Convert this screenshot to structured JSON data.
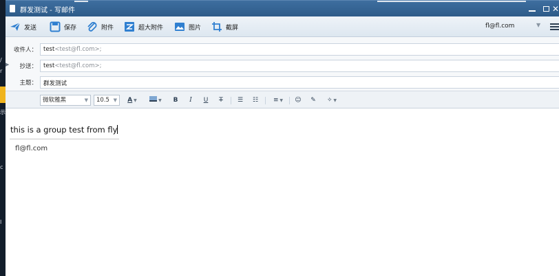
{
  "window": {
    "title": "群发测试 - 写邮件"
  },
  "toolbar": {
    "send": "发送",
    "save": "保存",
    "attach": "附件",
    "large_attach": "超大附件",
    "image": "图片",
    "screenshot": "截屏",
    "account": "fl@fl.com"
  },
  "fields": {
    "to_label": "收件人：",
    "to_name": "test",
    "to_addr": "<test@fl.com>;",
    "cc_label": "抄送：",
    "cc_name": "test",
    "cc_addr": "<test@fl.com>;",
    "subject_label": "主题：",
    "subject_value": "群发测试"
  },
  "format": {
    "font": "微软雅黑",
    "size": "10.5",
    "bold": "B",
    "italic": "I",
    "underline": "U",
    "strike": "T"
  },
  "body": {
    "text": "this is a group test from fly",
    "signature": "fl@fl.com"
  },
  "colors": {
    "titlebar": "#2d5b89",
    "toolbar": "#e4ecf4",
    "icon_blue": "#2f7fd0"
  }
}
